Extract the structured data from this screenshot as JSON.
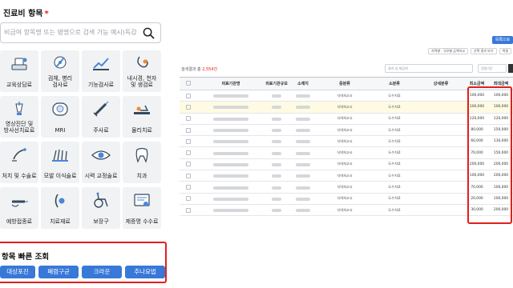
{
  "left": {
    "section_title": "진료비 항목",
    "required_mark": "*",
    "search_placeholder": "비급여 항목명 또는 병명으로 검색 가능 예시)독감",
    "tiles": [
      {
        "label": "교육상담료",
        "icon": "consult-icon"
      },
      {
        "label": "검체, 병리\n검사료",
        "icon": "specimen-icon"
      },
      {
        "label": "기능검사료",
        "icon": "function-test-icon"
      },
      {
        "label": "내시경, 천자\n및 생검료",
        "icon": "endoscope-icon"
      },
      {
        "label": "영상진단 및\n방사선치료료",
        "icon": "xray-icon"
      },
      {
        "label": "MRI",
        "icon": "mri-icon"
      },
      {
        "label": "주사료",
        "icon": "injection-icon"
      },
      {
        "label": "물리치료",
        "icon": "physical-therapy-icon"
      },
      {
        "label": "처치 및 수술료",
        "icon": "surgery-icon"
      },
      {
        "label": "모발 이식술료",
        "icon": "hair-transplant-icon"
      },
      {
        "label": "시력 교정술료",
        "icon": "eye-icon"
      },
      {
        "label": "치과",
        "icon": "tooth-icon"
      },
      {
        "label": "예방접종료",
        "icon": "vaccine-icon"
      },
      {
        "label": "치료재료",
        "icon": "material-icon"
      },
      {
        "label": "보장구",
        "icon": "wheelchair-icon"
      },
      {
        "label": "제증명 수수료",
        "icon": "certificate-icon"
      }
    ],
    "quick_title": "항목 빠른 조회",
    "quick_chips": [
      "대상포진",
      "폐렴구균",
      "크라운",
      "추나요법"
    ]
  },
  "right": {
    "top_button": "목록으로",
    "buttons": [
      "지역별 · 규모별 금액비교",
      "선택 결과 보기",
      "엑셀"
    ],
    "result_text": "검색결과 총",
    "result_count": "2,554건",
    "filter_placeholder": "결과 내 재검색",
    "sort_label": "정렬기준",
    "columns": [
      "",
      "의료기관명",
      "의료기관규모",
      "소재지",
      "중분류",
      "소분류",
      "상세분류",
      "최소금액",
      "최대금액"
    ],
    "rows": [
      {
        "mid": "식약처고시",
        "sub": "도수치료",
        "min": "100,000",
        "max": "100,000"
      },
      {
        "mid": "식약처고시",
        "sub": "도수치료",
        "min": "100,000",
        "max": "100,000"
      },
      {
        "mid": "식약처고시",
        "sub": "도수치료",
        "min": "120,000",
        "max": "120,000"
      },
      {
        "mid": "식약처고시",
        "sub": "도수치료",
        "min": "80,000",
        "max": "150,000"
      },
      {
        "mid": "식약처고시",
        "sub": "도수치료",
        "min": "60,000",
        "max": "130,000"
      },
      {
        "mid": "식약처고시",
        "sub": "도수치료",
        "min": "70,000",
        "max": "150,000"
      },
      {
        "mid": "식약처고시",
        "sub": "도수치료",
        "min": "200,000",
        "max": "200,000"
      },
      {
        "mid": "식약처고시",
        "sub": "도수치료",
        "min": "100,000",
        "max": "200,000"
      },
      {
        "mid": "식약처고시",
        "sub": "도수치료",
        "min": "70,000",
        "max": "100,000"
      },
      {
        "mid": "식약처고시",
        "sub": "도수치료",
        "min": "20,000",
        "max": "100,000"
      },
      {
        "mid": "식약처고시",
        "sub": "도수치료",
        "min": "30,000",
        "max": "200,000"
      }
    ],
    "highlight_color": "#e0201b",
    "accent_color": "#3878d8"
  }
}
